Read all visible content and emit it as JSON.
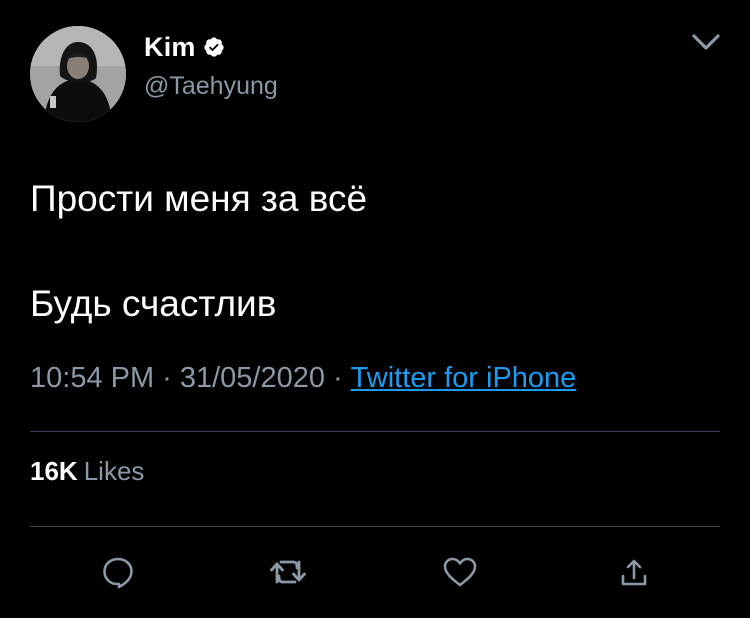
{
  "tweet": {
    "author_name": "Kim",
    "handle": "@Taehyung",
    "text_lines": [
      "Прости меня за всё",
      "Будь счастлив"
    ],
    "time": "10:54 PM",
    "separator": "·",
    "date": "31/05/2020",
    "source": "Twitter for iPhone",
    "likes_count": "16K",
    "likes_label": "Likes"
  },
  "icons": {
    "verified": "verified-badge-icon",
    "menu": "chevron-down-icon",
    "actions": [
      "reply-icon",
      "retweet-icon",
      "like-icon",
      "share-icon"
    ]
  },
  "colors": {
    "background": "#000000",
    "text_primary": "#ffffff",
    "text_secondary": "#8b98a5",
    "link": "#1d9bf0",
    "divider": "#38444d"
  }
}
